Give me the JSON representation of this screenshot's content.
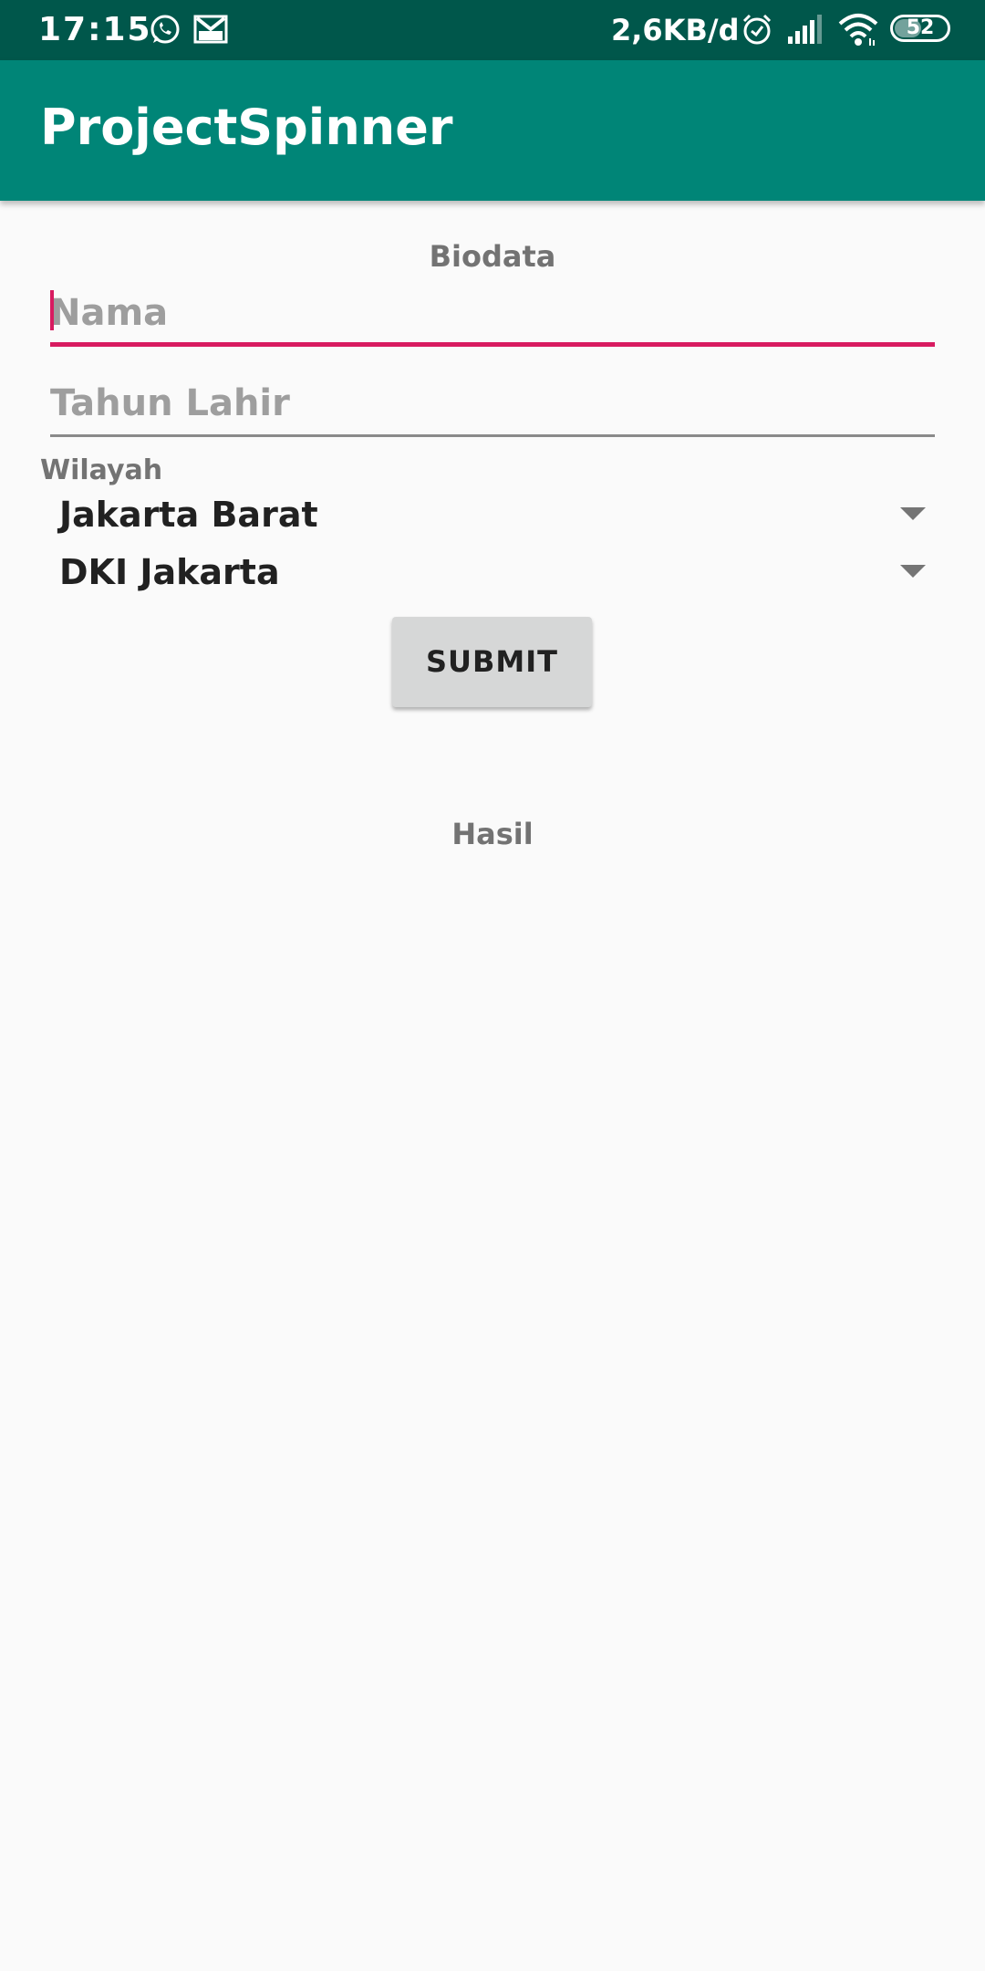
{
  "status_bar": {
    "time": "17:15",
    "network_speed": "2,6KB/d",
    "battery_level": "52",
    "battery_fraction": 0.52,
    "icons": [
      "whatsapp-icon",
      "gmail-icon",
      "alarm-icon",
      "signal-icon",
      "wifi-icon",
      "battery-icon"
    ]
  },
  "app_bar": {
    "title": "ProjectSpinner",
    "color": "#008577"
  },
  "form": {
    "header": "Biodata",
    "name_placeholder": "Nama",
    "name_value": "",
    "year_placeholder": "Tahun Lahir",
    "year_value": "",
    "region_label": "Wilayah",
    "city_selected": "Jakarta Barat",
    "province_selected": "DKI Jakarta",
    "submit_label": "SUBMIT"
  },
  "result": {
    "header": "Hasil"
  },
  "colors": {
    "status_bar": "#00574b",
    "primary": "#008577",
    "accent": "#d81b60",
    "background": "#fafafa"
  }
}
